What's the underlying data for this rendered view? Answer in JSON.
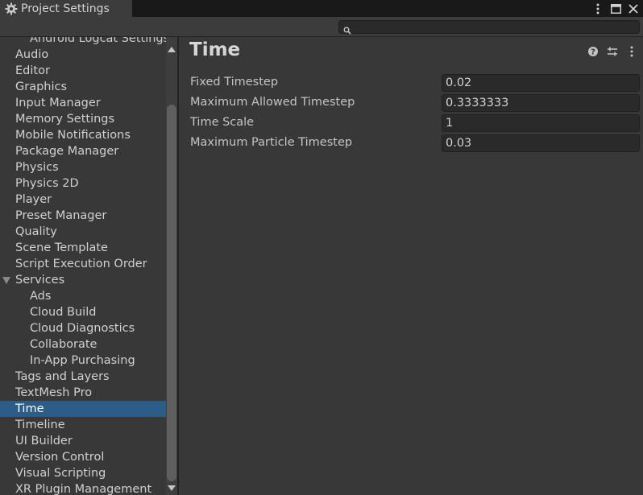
{
  "window": {
    "tab_label": "Project Settings"
  },
  "search": {
    "placeholder": ""
  },
  "sidebar": {
    "partial_item": "Android Logcat Settings",
    "items": [
      {
        "label": "Audio",
        "level": 0
      },
      {
        "label": "Editor",
        "level": 0
      },
      {
        "label": "Graphics",
        "level": 0
      },
      {
        "label": "Input Manager",
        "level": 0
      },
      {
        "label": "Memory Settings",
        "level": 0
      },
      {
        "label": "Mobile Notifications",
        "level": 0
      },
      {
        "label": "Package Manager",
        "level": 0
      },
      {
        "label": "Physics",
        "level": 0
      },
      {
        "label": "Physics 2D",
        "level": 0
      },
      {
        "label": "Player",
        "level": 0
      },
      {
        "label": "Preset Manager",
        "level": 0
      },
      {
        "label": "Quality",
        "level": 0
      },
      {
        "label": "Scene Template",
        "level": 0
      },
      {
        "label": "Script Execution Order",
        "level": 0
      },
      {
        "label": "Services",
        "level": 0,
        "expanded": true
      },
      {
        "label": "Ads",
        "level": 1
      },
      {
        "label": "Cloud Build",
        "level": 1
      },
      {
        "label": "Cloud Diagnostics",
        "level": 1
      },
      {
        "label": "Collaborate",
        "level": 1
      },
      {
        "label": "In-App Purchasing",
        "level": 1
      },
      {
        "label": "Tags and Layers",
        "level": 0
      },
      {
        "label": "TextMesh Pro",
        "level": 0
      },
      {
        "label": "Time",
        "level": 0,
        "selected": true
      },
      {
        "label": "Timeline",
        "level": 0
      },
      {
        "label": "UI Builder",
        "level": 0
      },
      {
        "label": "Version Control",
        "level": 0
      },
      {
        "label": "Visual Scripting",
        "level": 0
      },
      {
        "label": "XR Plugin Management",
        "level": 0
      }
    ]
  },
  "main": {
    "title": "Time",
    "properties": [
      {
        "label": "Fixed Timestep",
        "value": "0.02"
      },
      {
        "label": "Maximum Allowed Timestep",
        "value": "0.3333333"
      },
      {
        "label": "Time Scale",
        "value": "1"
      },
      {
        "label": "Maximum Particle Timestep",
        "value": "0.03"
      }
    ]
  },
  "icons": {
    "tab": "gear-icon",
    "window": [
      "more-vert-icon",
      "maximize-icon",
      "close-icon"
    ],
    "search": "search-icon",
    "header": [
      "help-icon",
      "preset-sliders-icon",
      "more-vert-icon"
    ]
  },
  "colors": {
    "selected_bg": "#2c5d87",
    "panel_bg": "#383838",
    "field_bg": "#2a2a2a"
  }
}
